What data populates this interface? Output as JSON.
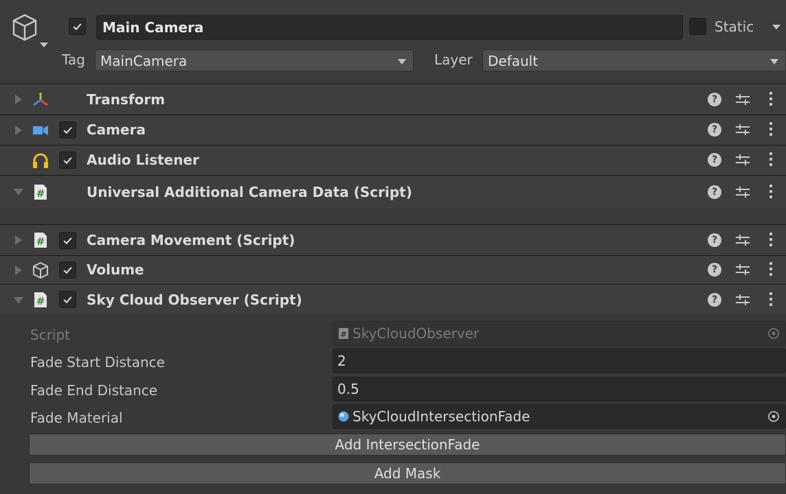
{
  "header": {
    "active_checked": true,
    "object_name": "Main Camera",
    "static_label": "Static",
    "tag_label": "Tag",
    "tag_value": "MainCamera",
    "layer_label": "Layer",
    "layer_value": "Default",
    "icon": "cube-outline-icon"
  },
  "components": [
    {
      "title": "Transform",
      "icon": "transform-axes-icon",
      "has_checkbox": false,
      "expanded": false
    },
    {
      "title": "Camera",
      "icon": "camera-icon",
      "has_checkbox": true,
      "expanded": false
    },
    {
      "title": "Audio Listener",
      "icon": "headphones-icon",
      "has_checkbox": true,
      "expanded": false
    },
    {
      "title": "Universal Additional Camera Data (Script)",
      "icon": "script-hash-icon",
      "has_checkbox": false,
      "expanded": true
    },
    {
      "title": "Camera Movement (Script)",
      "icon": "script-hash-icon",
      "has_checkbox": true,
      "expanded": false
    },
    {
      "title": "Volume",
      "icon": "cube-outline-icon",
      "has_checkbox": true,
      "expanded": false
    },
    {
      "title": "Sky Cloud Observer (Script)",
      "icon": "script-hash-icon",
      "has_checkbox": true,
      "expanded": true
    }
  ],
  "tools": {
    "help": "?"
  },
  "properties": {
    "script_label": "Script",
    "script_value": "SkyCloudObserver",
    "fade_start_label": "Fade Start Distance",
    "fade_start_value": "2",
    "fade_end_label": "Fade End Distance",
    "fade_end_value": "0.5",
    "fade_material_label": "Fade Material",
    "fade_material_value": "SkyCloudIntersectionFade"
  },
  "buttons": {
    "add_intersection": "Add IntersectionFade",
    "add_mask": "Add Mask"
  },
  "colors": {
    "accent_yellow": "#f0c020",
    "camera_blue": "#5aa0e6",
    "script_green": "#3c8a3c"
  }
}
